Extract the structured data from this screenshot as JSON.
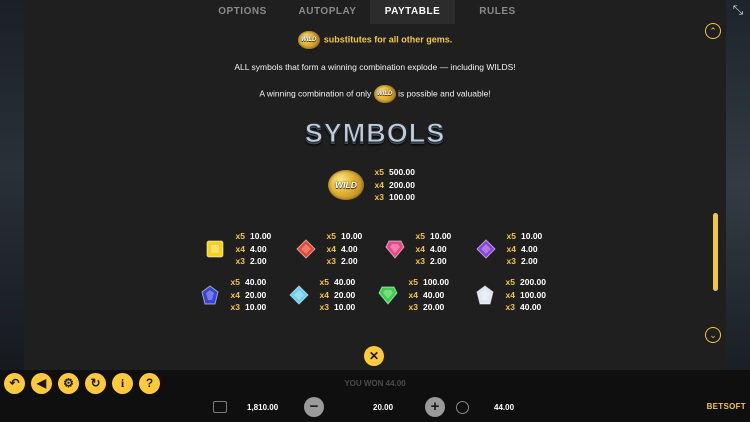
{
  "tabs": [
    {
      "label": "OPTIONS",
      "active": false
    },
    {
      "label": "AUTOPLAY",
      "active": false
    },
    {
      "label": "PAYTABLE",
      "active": true
    },
    {
      "label": "RULES",
      "active": false
    }
  ],
  "fullscreen_icon": "compress-icon",
  "wild_badge_text": "WILD",
  "intro": {
    "line1": "substitutes for all other gems.",
    "line2": "ALL symbols that form a winning combination explode — including WILDS!",
    "line3_before": "A winning combination of only",
    "line3_after": "is possible and valuable!"
  },
  "symbols_title": "SYMBOLS",
  "wild_pays": [
    {
      "mult": "x5",
      "value": "500.00"
    },
    {
      "mult": "x4",
      "value": "200.00"
    },
    {
      "mult": "x3",
      "value": "100.00"
    }
  ],
  "gems": [
    {
      "name": "yellow-gem",
      "color": "#f6d21a",
      "shape": "square",
      "pays": [
        {
          "mult": "x5",
          "value": "10.00"
        },
        {
          "mult": "x4",
          "value": "4.00"
        },
        {
          "mult": "x3",
          "value": "2.00"
        }
      ]
    },
    {
      "name": "red-gem",
      "color": "#e8432f",
      "shape": "diamond",
      "pays": [
        {
          "mult": "x5",
          "value": "10.00"
        },
        {
          "mult": "x4",
          "value": "4.00"
        },
        {
          "mult": "x3",
          "value": "2.00"
        }
      ]
    },
    {
      "name": "pink-gem",
      "color": "#e8478a",
      "shape": "shield",
      "pays": [
        {
          "mult": "x5",
          "value": "10.00"
        },
        {
          "mult": "x4",
          "value": "4.00"
        },
        {
          "mult": "x3",
          "value": "2.00"
        }
      ]
    },
    {
      "name": "purple-gem",
      "color": "#8a3fe0",
      "shape": "diamond",
      "pays": [
        {
          "mult": "x5",
          "value": "10.00"
        },
        {
          "mult": "x4",
          "value": "4.00"
        },
        {
          "mult": "x3",
          "value": "2.00"
        }
      ]
    },
    {
      "name": "blue-gem",
      "color": "#3a44d6",
      "shape": "rhombus",
      "pays": [
        {
          "mult": "x5",
          "value": "40.00"
        },
        {
          "mult": "x4",
          "value": "20.00"
        },
        {
          "mult": "x3",
          "value": "10.00"
        }
      ]
    },
    {
      "name": "cyan-gem",
      "color": "#6ad0f0",
      "shape": "diamond",
      "pays": [
        {
          "mult": "x5",
          "value": "40.00"
        },
        {
          "mult": "x4",
          "value": "20.00"
        },
        {
          "mult": "x3",
          "value": "10.00"
        }
      ]
    },
    {
      "name": "green-gem",
      "color": "#3bcf4a",
      "shape": "shield",
      "pays": [
        {
          "mult": "x5",
          "value": "100.00"
        },
        {
          "mult": "x4",
          "value": "40.00"
        },
        {
          "mult": "x3",
          "value": "20.00"
        }
      ]
    },
    {
      "name": "white-gem",
      "color": "#dfe8f2",
      "shape": "rhombus",
      "pays": [
        {
          "mult": "x5",
          "value": "200.00"
        },
        {
          "mult": "x4",
          "value": "100.00"
        },
        {
          "mult": "x3",
          "value": "40.00"
        }
      ]
    }
  ],
  "controls": {
    "icons": [
      "back-icon",
      "sound-icon",
      "settings-icon",
      "autoplay-icon",
      "info-icon",
      "help-icon"
    ],
    "icon_glyphs": [
      "↶",
      "◀",
      "⚙",
      "↻",
      "i",
      "?"
    ],
    "close_glyph": "✕",
    "scroll_up_glyph": "⌃",
    "scroll_down_glyph": "⌄",
    "minus_glyph": "−",
    "plus_glyph": "+"
  },
  "status": {
    "won_text": "YOU WON 44.00",
    "balance": "1,810.00",
    "bet": "20.00",
    "win": "44.00"
  },
  "brand": "BETSOFT",
  "colors": {
    "accent": "#ffc93c",
    "panel": "#1f1f1f",
    "text_gold": "#f4c542"
  }
}
